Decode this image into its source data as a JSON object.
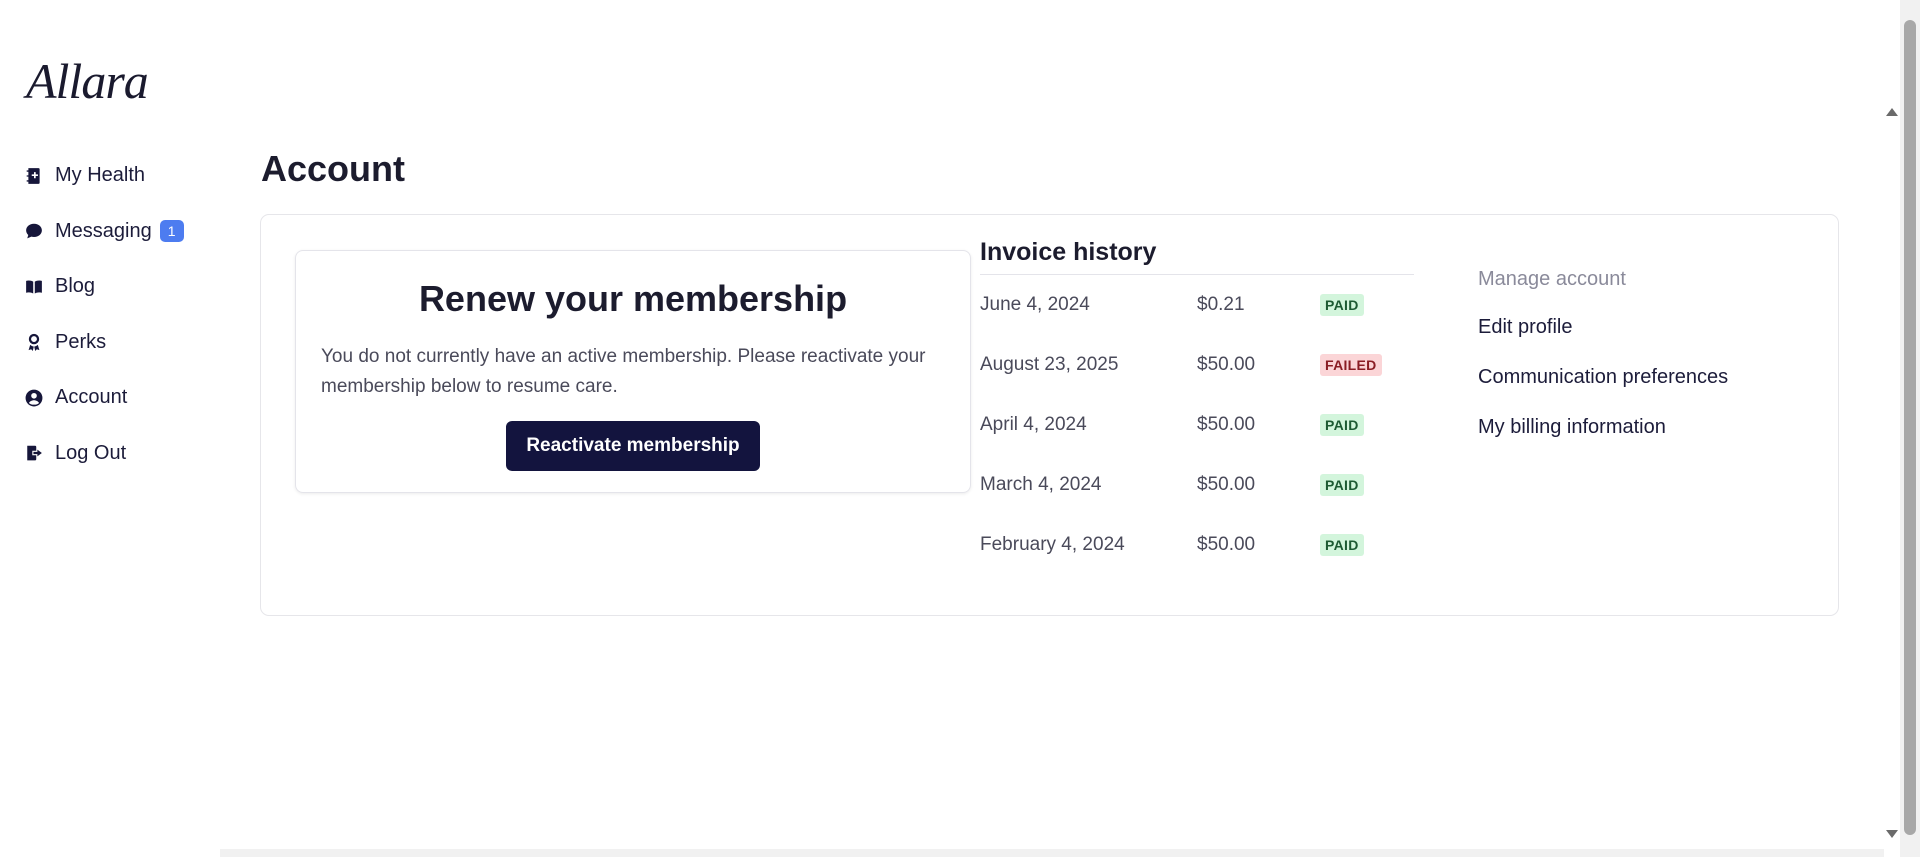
{
  "brand": {
    "logo_text": "Allara"
  },
  "sidebar": {
    "items": [
      {
        "label": "My Health",
        "icon": "health-notebook-icon"
      },
      {
        "label": "Messaging",
        "icon": "chat-bubble-icon",
        "badge": "1"
      },
      {
        "label": "Blog",
        "icon": "open-book-icon"
      },
      {
        "label": "Perks",
        "icon": "award-ribbon-icon"
      },
      {
        "label": "Account",
        "icon": "user-circle-icon"
      },
      {
        "label": "Log Out",
        "icon": "logout-icon"
      }
    ]
  },
  "page": {
    "title": "Account"
  },
  "renew": {
    "title": "Renew your membership",
    "text": "You do not currently have an active membership. Please reactivate your membership below to resume care.",
    "button_label": "Reactivate membership"
  },
  "invoices": {
    "title": "Invoice history",
    "rows": [
      {
        "date": "June 4, 2024",
        "amount": "$0.21",
        "status": "PAID"
      },
      {
        "date": "August 23, 2025",
        "amount": "$50.00",
        "status": "FAILED"
      },
      {
        "date": "April 4, 2024",
        "amount": "$50.00",
        "status": "PAID"
      },
      {
        "date": "March 4, 2024",
        "amount": "$50.00",
        "status": "PAID"
      },
      {
        "date": "February 4, 2024",
        "amount": "$50.00",
        "status": "PAID"
      }
    ]
  },
  "manage": {
    "heading": "Manage account",
    "links": [
      {
        "label": "Edit profile"
      },
      {
        "label": "Communication preferences"
      },
      {
        "label": "My billing information"
      }
    ]
  },
  "colors": {
    "primary_button": "#13143e",
    "badge": "#4d7cf0",
    "paid_bg": "#d3f5dc",
    "failed_bg": "#fbd5d7"
  }
}
